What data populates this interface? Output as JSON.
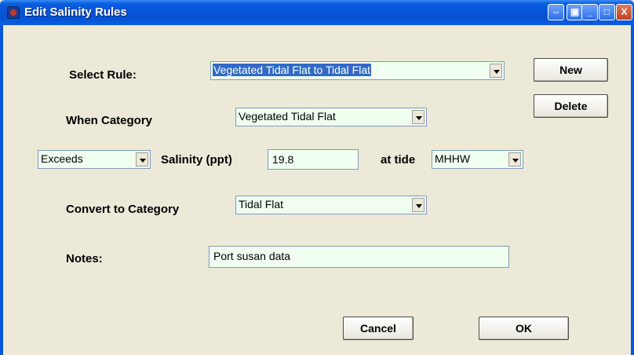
{
  "window": {
    "title": "Edit Salinity Rules",
    "controls": [
      "⇔",
      "▣",
      "_",
      "□",
      "X"
    ]
  },
  "select_rule": {
    "label": "Select Rule:",
    "value": "Vegetated Tidal Flat to Tidal Flat"
  },
  "when_category": {
    "label": "When Category",
    "value": "Vegetated Tidal Flat"
  },
  "condition": {
    "comparator": "Exceeds",
    "salinity_label": "Salinity (ppt)",
    "salinity_value": "19.8",
    "tide_label": "at tide",
    "tide_value": "MHHW"
  },
  "convert": {
    "label": "Convert to Category",
    "value": "Tidal Flat"
  },
  "notes": {
    "label": "Notes:",
    "value": "Port susan data"
  },
  "buttons": {
    "new": "New",
    "delete": "Delete",
    "cancel": "Cancel",
    "ok": "OK"
  }
}
